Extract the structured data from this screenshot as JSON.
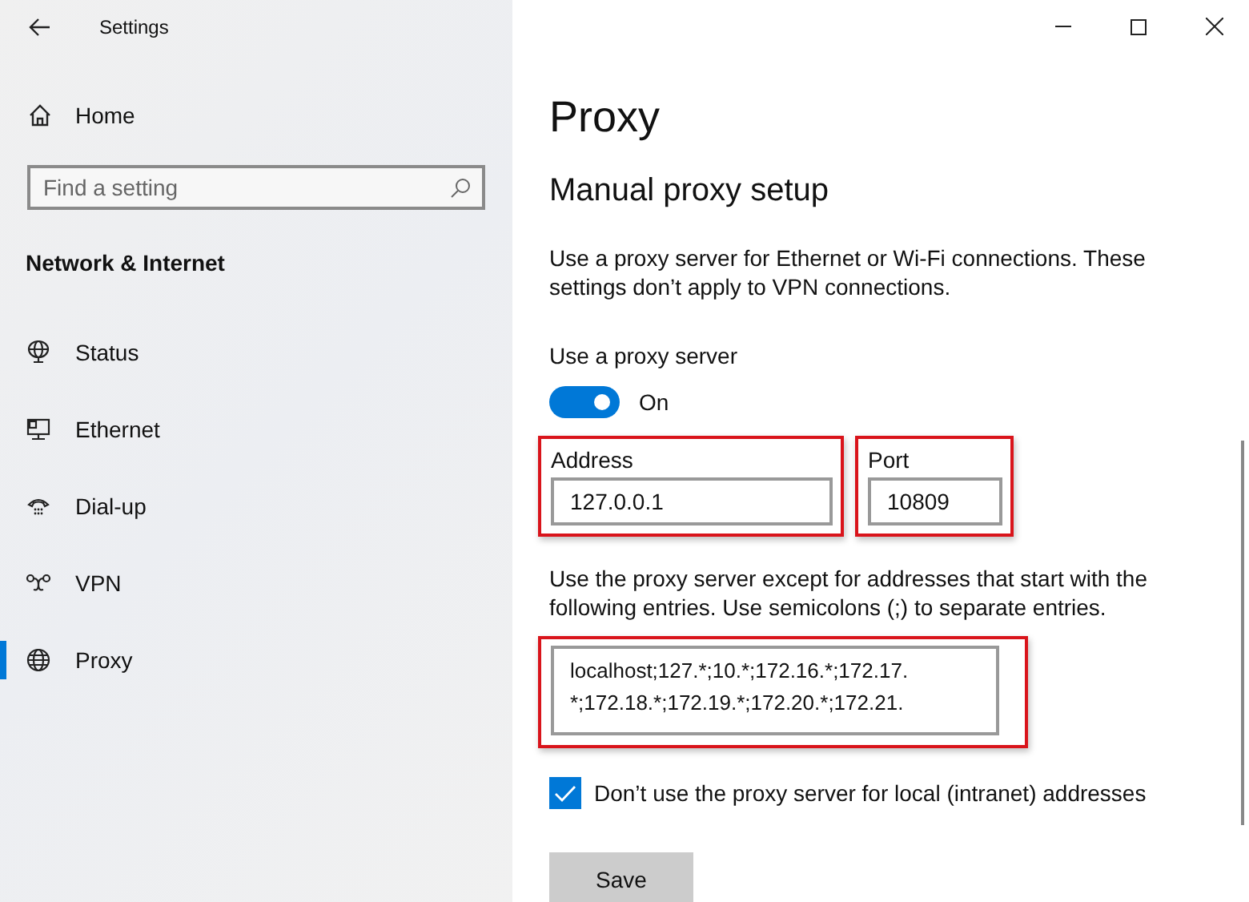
{
  "window": {
    "title": "Settings"
  },
  "sidebar": {
    "home": "Home",
    "search": {
      "placeholder": "Find a setting"
    },
    "section": "Network & Internet",
    "items": [
      {
        "label": "Status",
        "selected": false
      },
      {
        "label": "Ethernet",
        "selected": false
      },
      {
        "label": "Dial-up",
        "selected": false
      },
      {
        "label": "VPN",
        "selected": false
      },
      {
        "label": "Proxy",
        "selected": true
      }
    ]
  },
  "page": {
    "title": "Proxy",
    "section": "Manual proxy setup",
    "description": "Use a proxy server for Ethernet or Wi-Fi connections. These settings don’t apply to VPN connections.",
    "toggle": {
      "label": "Use a proxy server",
      "on": true,
      "state": "On"
    },
    "address": {
      "label": "Address",
      "value": "127.0.0.1",
      "highlighted": true
    },
    "port": {
      "label": "Port",
      "value": "10809",
      "highlighted": true
    },
    "exceptions": {
      "description": "Use the proxy server except for addresses that start with the following entries. Use semicolons (;) to separate entries.",
      "highlighted": true,
      "lines": [
        "localhost;127.*;10.*;172.16.*;172.17.",
        "*;172.18.*;172.19.*;172.20.*;172.21."
      ]
    },
    "local_bypass": {
      "label": "Don’t use the proxy server for local (intranet) addresses",
      "checked": true
    },
    "save": "Save"
  }
}
